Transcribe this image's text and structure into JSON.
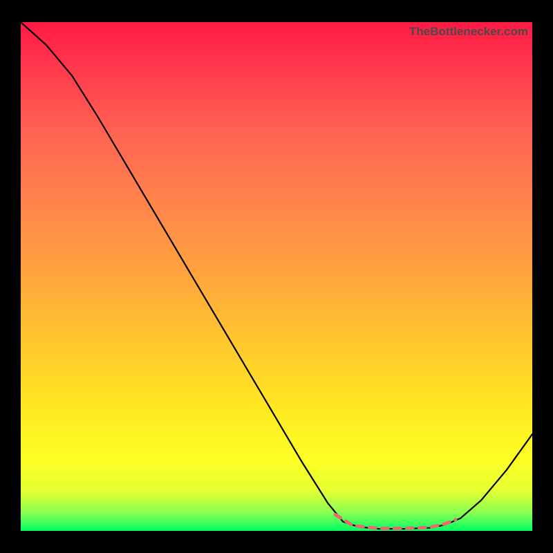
{
  "watermark_text": "TheBottlenecker.com",
  "chart_data": {
    "type": "line",
    "title": "",
    "xlabel": "",
    "ylabel": "",
    "xlim": [
      0,
      100
    ],
    "ylim": [
      0,
      100
    ],
    "background": "rainbow-gradient-vertical",
    "series": [
      {
        "name": "main-curve",
        "color": "#000000",
        "width": 2.2,
        "points": [
          {
            "x": 0,
            "y": 100
          },
          {
            "x": 5,
            "y": 95.5
          },
          {
            "x": 10,
            "y": 89.5
          },
          {
            "x": 15,
            "y": 81.5
          },
          {
            "x": 20,
            "y": 73
          },
          {
            "x": 25,
            "y": 64.5
          },
          {
            "x": 30,
            "y": 56
          },
          {
            "x": 35,
            "y": 47.5
          },
          {
            "x": 40,
            "y": 39
          },
          {
            "x": 45,
            "y": 30.5
          },
          {
            "x": 50,
            "y": 22
          },
          {
            "x": 55,
            "y": 13.5
          },
          {
            "x": 60,
            "y": 5.5
          },
          {
            "x": 63,
            "y": 1.8
          },
          {
            "x": 66,
            "y": 0.8
          },
          {
            "x": 70,
            "y": 0.4
          },
          {
            "x": 75,
            "y": 0.4
          },
          {
            "x": 80,
            "y": 0.6
          },
          {
            "x": 83,
            "y": 1.2
          },
          {
            "x": 86,
            "y": 2.5
          },
          {
            "x": 90,
            "y": 6
          },
          {
            "x": 95,
            "y": 12
          },
          {
            "x": 100,
            "y": 19
          }
        ]
      },
      {
        "name": "dashed-highlight",
        "color": "#e86a6e",
        "dash": true,
        "width": 5,
        "points": [
          {
            "x": 61.5,
            "y": 3.2
          },
          {
            "x": 65,
            "y": 1.0
          },
          {
            "x": 70,
            "y": 0.5
          },
          {
            "x": 75,
            "y": 0.5
          },
          {
            "x": 80,
            "y": 0.7
          },
          {
            "x": 83,
            "y": 1.4
          },
          {
            "x": 85,
            "y": 2.2
          }
        ]
      }
    ]
  }
}
